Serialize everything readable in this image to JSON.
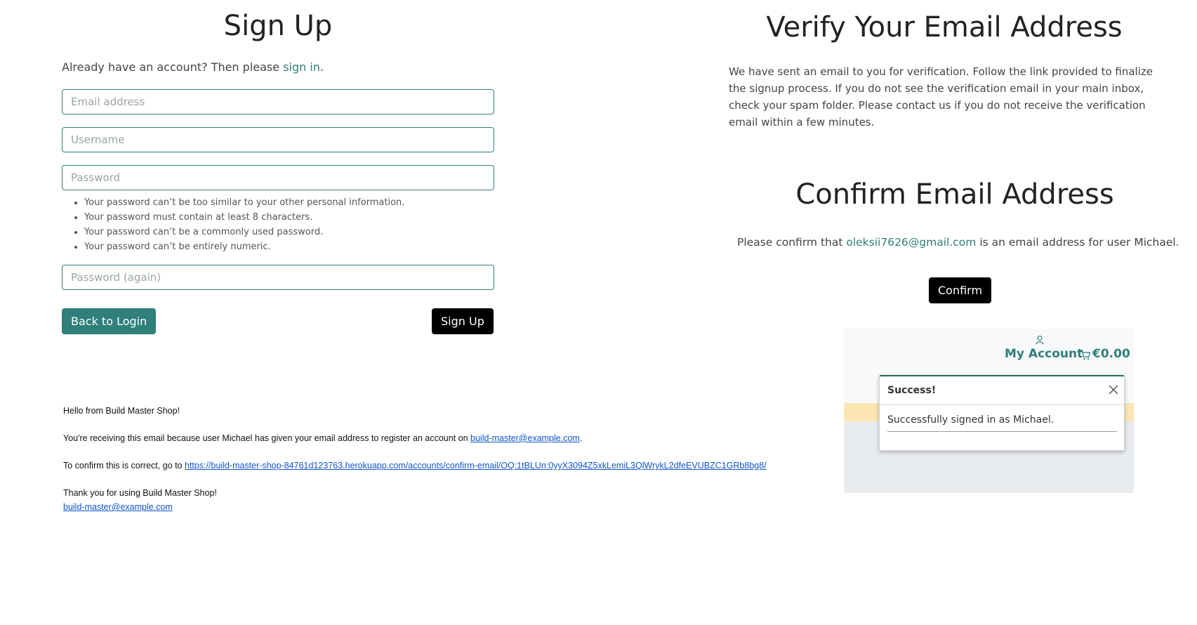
{
  "signup": {
    "title": "Sign Up",
    "prompt_prefix": "Already have an account? Then please",
    "signin_link": "sign in",
    "prompt_suffix": ".",
    "email_placeholder": "Email address",
    "username_placeholder": "Username",
    "password_placeholder": "Password",
    "password_again_placeholder": "Password (again)",
    "rules": [
      "Your password can’t be too similar to your other personal information.",
      "Your password must contain at least 8 characters.",
      "Your password can’t be a commonly used password.",
      "Your password can’t be entirely numeric."
    ],
    "back_button": "Back to Login",
    "signup_button": "Sign Up"
  },
  "email": {
    "greeting": "Hello from Build Master Shop!",
    "line1_prefix": "You're receiving this email because user Michael has given your email address to register an account on",
    "line1_link": "build-master@example.com",
    "line1_suffix": ".",
    "line2_prefix": "To confirm this is correct, go to",
    "line2_link": "https://build-master-shop-84761d123763.herokuapp.com/accounts/confirm-email/OQ:1tBLUn:0yyX3094Z5xkLemiL3QlWrykL2dfeEVUBZC1GRb8bg8/",
    "thanks": "Thank you for using Build Master Shop!",
    "signature_link": "build-master@example.com"
  },
  "verify": {
    "title": "Verify Your Email Address",
    "body": "We have sent an email to you for verification. Follow the link provided to finalize the signup process. If you do not see the verification email in your main inbox, check your spam folder. Please contact us if you do not receive the verification email within a few minutes."
  },
  "confirm": {
    "title": "Confirm Email Address",
    "prefix": "Please confirm that",
    "email_link": "oleksii7626@gmail.com",
    "suffix": "is an email address for user Michael.",
    "button": "Confirm"
  },
  "message": {
    "account_label": "My Account",
    "cart_total": "€0.00",
    "toast_title": "Success!",
    "toast_body": "Successfully signed in as Michael."
  },
  "colors": {
    "accent": "#2f7f7a",
    "dark_button": "#000000",
    "toast_border": "#1e6e4e",
    "banner": "#fbe6b3"
  }
}
